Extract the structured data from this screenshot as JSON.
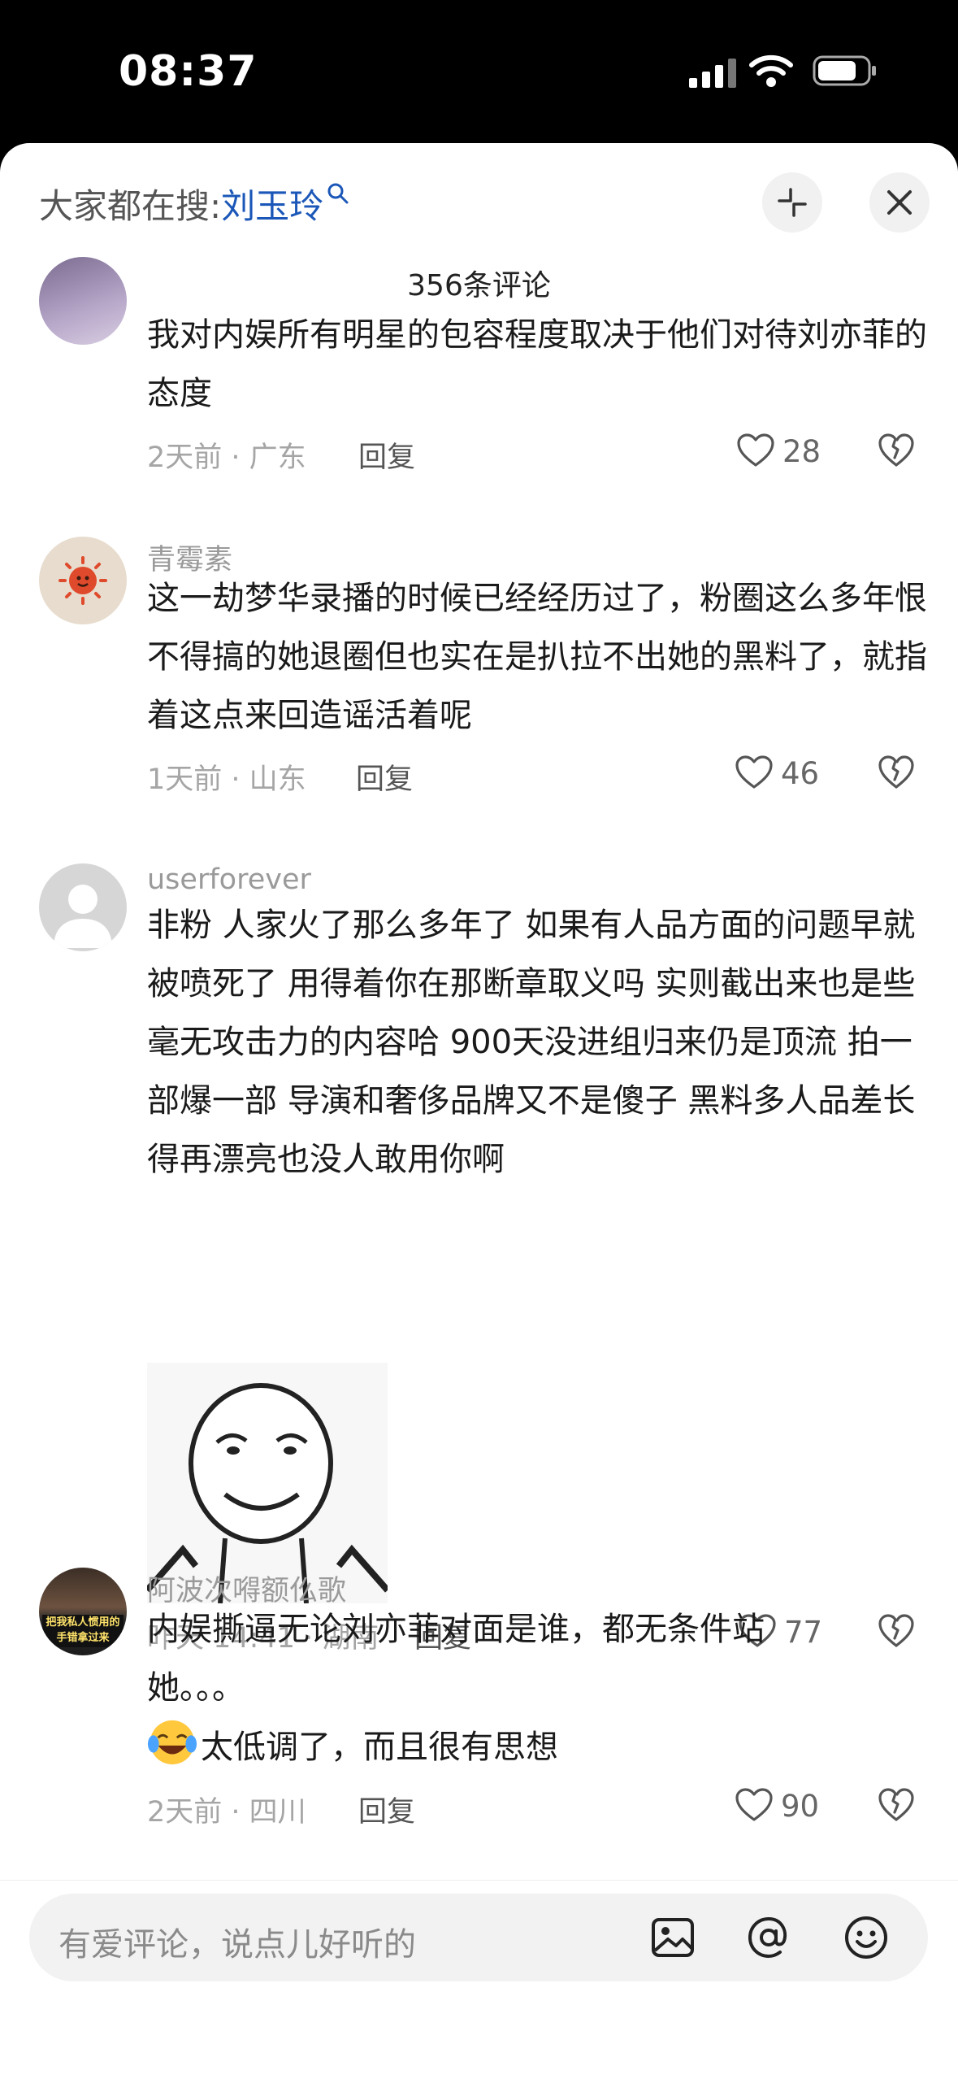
{
  "status_bar": {
    "time": "08:37"
  },
  "header": {
    "trending_prefix": "大家都在搜:",
    "trending_keyword": "刘玉玲",
    "comment_count_title": "356条评论"
  },
  "comments": [
    {
      "text": "我对内娱所有明星的包容程度取决于他们对待刘亦菲的态度",
      "time_location": "2天前 · 广东",
      "reply": "回复",
      "likes": "28"
    },
    {
      "username": "青霉素",
      "text": "这一劫梦华录播的时候已经经历过了，粉圈这么多年恨不得搞的她退圈但也实在是扒拉不出她的黑料了，就指着这点来回造谣活着呢",
      "time_location": "1天前 · 山东",
      "reply": "回复",
      "likes": "46"
    },
    {
      "username": "userforever",
      "text": "非粉 人家火了那么多年了 如果有人品方面的问题早就被喷死了 用得着你在那断章取义吗 实则截出来也是些毫无攻击力的内容哈 900天没进组归来仍是顶流 拍一部爆一部 导演和奢侈品牌又不是傻子 黑料多人品差长得再漂亮也没人敢用你啊",
      "time_location": "昨天 14:41 · 湖南",
      "reply": "回复",
      "likes": "77"
    },
    {
      "username": "阿波次嘚额仫歌",
      "avatar_caption": "把我私人惯用的手错拿过来",
      "text": "内娱撕逼无论刘亦菲对面是谁，都无条件站她。。。",
      "text2": "太低调了，而且很有思想",
      "time_location": "2天前 · 四川",
      "reply": "回复",
      "likes": "90"
    }
  ],
  "bottom_bar": {
    "placeholder": "有爱评论，说点儿好听的"
  },
  "colors": {
    "keyword": "#1b57b8",
    "meta": "#a5a5a5",
    "background": "#ffffff"
  }
}
